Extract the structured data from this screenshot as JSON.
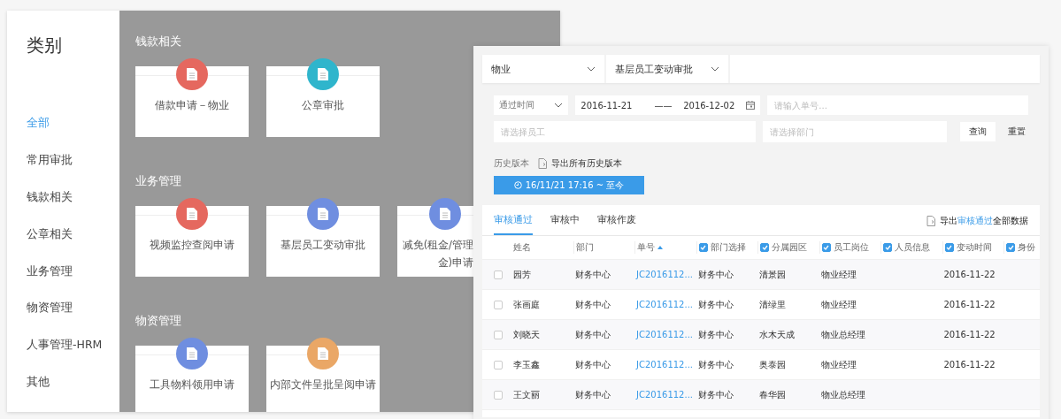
{
  "category_window": {
    "title": "类别",
    "sidebar": {
      "items": [
        {
          "label": "全部",
          "selected": true
        },
        {
          "label": "常用审批",
          "selected": false
        },
        {
          "label": "钱款相关",
          "selected": false
        },
        {
          "label": "公章相关",
          "selected": false
        },
        {
          "label": "业务管理",
          "selected": false
        },
        {
          "label": "物资管理",
          "selected": false
        },
        {
          "label": "人事管理-HRM",
          "selected": false
        },
        {
          "label": "其他",
          "selected": false
        }
      ]
    },
    "sections": [
      {
        "heading": "钱款相关",
        "cards": [
          {
            "lines": [
              "借款申请－物业"
            ],
            "color": "#e5685f"
          },
          {
            "lines": [
              "公章审批"
            ],
            "color": "#2fb5cc"
          }
        ]
      },
      {
        "heading": "业务管理",
        "cards": [
          {
            "lines": [
              "视频监控查阅申请"
            ],
            "color": "#e5685f"
          },
          {
            "lines": [
              "基层员工变动审批"
            ],
            "color": "#6f8ee0"
          },
          {
            "lines": [
              "减免(租金/管理",
              "金)申请"
            ],
            "color": "#6f8ee0",
            "covered": true
          }
        ]
      },
      {
        "heading": "物资管理",
        "cards": [
          {
            "lines": [
              "工具物料领用申请"
            ],
            "color": "#6f8ee0"
          },
          {
            "lines": [
              "内部文件呈批呈阅申请"
            ],
            "color": "#eaa766"
          }
        ]
      }
    ]
  },
  "approval_window": {
    "selects": [
      "物业",
      "基层员工变动审批"
    ],
    "filters": {
      "time_select": "通过时间",
      "date_from": "2016-11-21",
      "date_sep": "——",
      "date_to": "2016-12-02",
      "number_placeholder": "请输入单号...",
      "employee_placeholder": "请选择员工",
      "department_placeholder": "请选择部门",
      "query_button": "查询",
      "reset_button": "重置"
    },
    "history": {
      "label": "历史版本",
      "export": "导出所有历史版本",
      "version_button": "16/11/21 17:16 ~ 至今"
    },
    "tabs": [
      {
        "label": "审核通过",
        "selected": true
      },
      {
        "label": "审核中",
        "selected": false
      },
      {
        "label": "审核作废",
        "selected": false
      }
    ],
    "export_link": {
      "prefix": "导出",
      "highlight": "审核通过",
      "suffix": "全部数据"
    },
    "table": {
      "columns": [
        {
          "label": "姓名"
        },
        {
          "label": "部门"
        },
        {
          "label": "单号",
          "sortable": true
        },
        {
          "label": "部门选择",
          "checked": true
        },
        {
          "label": "分属园区",
          "checked": true
        },
        {
          "label": "员工岗位",
          "checked": true
        },
        {
          "label": "人员信息",
          "checked": true
        },
        {
          "label": "变动时间",
          "checked": true
        },
        {
          "label": "身份",
          "checked": true
        }
      ],
      "rows": [
        {
          "checked": false,
          "cells": [
            "园芳",
            "财务中心",
            "JC2016112...",
            "财务中心",
            "清景园",
            "物业经理",
            null,
            "2016-11-22"
          ]
        },
        {
          "checked": false,
          "cells": [
            "张画庭",
            "财务中心",
            "JC2016112...",
            "财务中心",
            "清绿里",
            "物业经理",
            null,
            "2016-11-22"
          ]
        },
        {
          "checked": false,
          "cells": [
            "刘晓天",
            "财务中心",
            "JC2016112...",
            "财务中心",
            "水木天成",
            "物业总经理",
            null,
            "2016-11-22"
          ]
        },
        {
          "checked": false,
          "cells": [
            "李玉鑫",
            "财务中心",
            "JC2016112...",
            "财务中心",
            "奥泰园",
            "物业经理",
            null,
            "2016-11-22"
          ]
        },
        {
          "checked": false,
          "cells": [
            "王文丽",
            "财务中心",
            "JC2016112...",
            "财务中心",
            "春华园",
            "物业总经理",
            null,
            null
          ]
        }
      ]
    }
  }
}
